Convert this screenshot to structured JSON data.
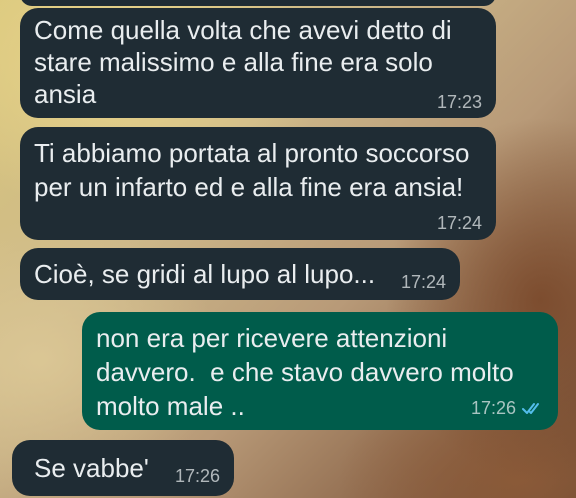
{
  "messages": [
    {
      "direction": "incoming",
      "lines": [
        "Come quella volta che avevi detto di",
        "stare malissimo e alla fine era solo",
        "ansia"
      ],
      "time": "17:23"
    },
    {
      "direction": "incoming",
      "lines": [
        "Ti abbiamo portata al pronto soccorso",
        "per un infarto ed e alla fine era ansia!"
      ],
      "time": "17:24"
    },
    {
      "direction": "incoming",
      "lines": [
        "Cioè, se gridi al lupo al lupo..."
      ],
      "time": "17:24"
    },
    {
      "direction": "outgoing",
      "lines": [
        "non era per ricevere attenzioni",
        "davvero.  e che stavo davvero molto",
        "molto male .."
      ],
      "time": "17:26",
      "status": "read"
    },
    {
      "direction": "incoming",
      "lines": [
        "Se vabbe'"
      ],
      "time": "17:26"
    }
  ],
  "colors": {
    "incoming_bubble": "#1f2c34",
    "outgoing_bubble": "#005c4b",
    "text": "#e9edef",
    "read_ticks": "#53bdeb"
  },
  "icons": {
    "read_receipt": "double-check-icon"
  }
}
